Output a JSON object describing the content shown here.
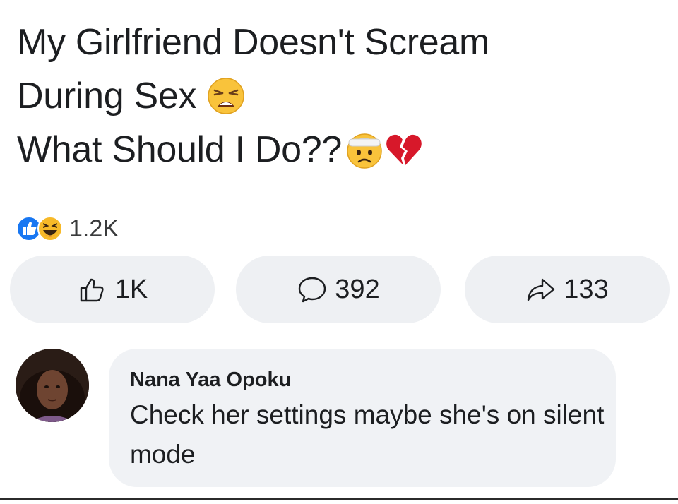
{
  "post": {
    "line1": "My Girlfriend Doesn't Scream",
    "line2": "During Sex",
    "line3": "What Should I Do??",
    "line2_emojis": [
      "weary-face-emoji"
    ],
    "line3_emojis": [
      "anxious-face-with-bandage-emoji",
      "broken-heart-emoji"
    ]
  },
  "reactions": {
    "icons": [
      "like-reaction-icon",
      "haha-reaction-icon"
    ],
    "count": "1.2K",
    "like_color": "#1877f2",
    "haha_color": "#f7b928"
  },
  "actions": {
    "like_count": "1K",
    "comment_count": "392",
    "share_count": "133",
    "icons": [
      "thumbs-up-icon",
      "comment-bubble-icon",
      "share-arrow-icon"
    ]
  },
  "comment": {
    "author": "Nana Yaa Opoku",
    "text": "Check her settings maybe she's on silent mode",
    "bubble_color": "#f0f2f5"
  }
}
